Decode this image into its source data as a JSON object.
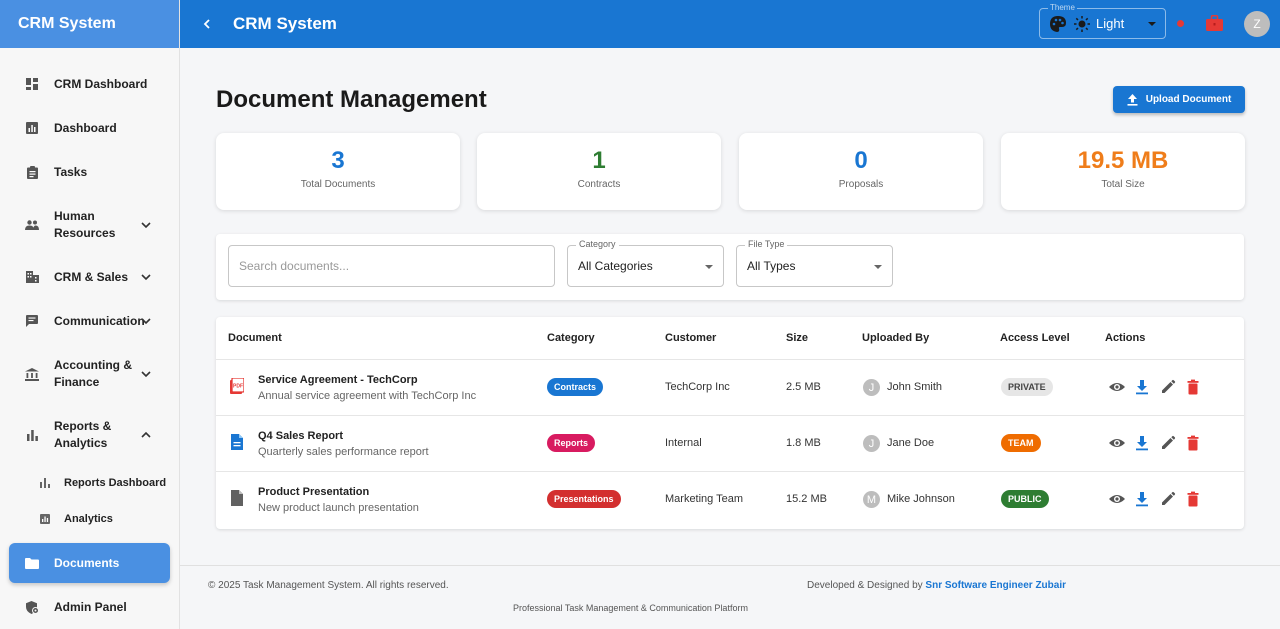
{
  "sidebar": {
    "brand": "CRM System",
    "items": [
      {
        "label": "CRM Dashboard"
      },
      {
        "label": "Dashboard"
      },
      {
        "label": "Tasks"
      },
      {
        "label": "Human Resources"
      },
      {
        "label": "CRM & Sales"
      },
      {
        "label": "Communication"
      },
      {
        "label": "Accounting & Finance"
      },
      {
        "label": "Reports & Analytics"
      },
      {
        "label": "Reports Dashboard"
      },
      {
        "label": "Analytics"
      },
      {
        "label": "Documents"
      },
      {
        "label": "Admin Panel"
      }
    ]
  },
  "topbar": {
    "title": "CRM System",
    "theme_label": "Theme",
    "theme_value": "Light",
    "avatar": "Z"
  },
  "main": {
    "title": "Document Management",
    "upload_label": "Upload Document",
    "stats": [
      {
        "value": "3",
        "label": "Total Documents",
        "color": "#1976d2"
      },
      {
        "value": "1",
        "label": "Contracts",
        "color": "#2e7d32"
      },
      {
        "value": "0",
        "label": "Proposals",
        "color": "#1976d2"
      },
      {
        "value": "19.5 MB",
        "label": "Total Size",
        "color": "#ef7d1a"
      }
    ],
    "filters": {
      "search_placeholder": "Search documents...",
      "category_label": "Category",
      "category_value": "All Categories",
      "filetype_label": "File Type",
      "filetype_value": "All Types"
    },
    "table": {
      "headers": [
        "Document",
        "Category",
        "Customer",
        "Size",
        "Uploaded By",
        "Access Level",
        "Actions"
      ],
      "rows": [
        {
          "name": "Service Agreement - TechCorp",
          "desc": "Annual service agreement with TechCorp Inc",
          "category": "Contracts",
          "category_color": "#1976d2",
          "customer": "TechCorp Inc",
          "size": "2.5 MB",
          "uploader_initial": "J",
          "uploader": "John Smith",
          "access": "PRIVATE",
          "icon": "pdf-icon"
        },
        {
          "name": "Q4 Sales Report",
          "desc": "Quarterly sales performance report",
          "category": "Reports",
          "category_color": "#d81b60",
          "customer": "Internal",
          "size": "1.8 MB",
          "uploader_initial": "J",
          "uploader": "Jane Doe",
          "access": "TEAM",
          "icon": "document-icon"
        },
        {
          "name": "Product Presentation",
          "desc": "New product launch presentation",
          "category": "Presentations",
          "category_color": "#d32f2f",
          "customer": "Marketing Team",
          "size": "15.2 MB",
          "uploader_initial": "M",
          "uploader": "Mike Johnson",
          "access": "PUBLIC",
          "icon": "file-icon"
        }
      ]
    }
  },
  "footer": {
    "copyright": "© 2025 Task Management System. All rights reserved.",
    "credit_prefix": "Developed & Designed by",
    "credit_name": "Snr Software Engineer Zubair",
    "tagline": "Professional Task Management & Communication Platform"
  }
}
